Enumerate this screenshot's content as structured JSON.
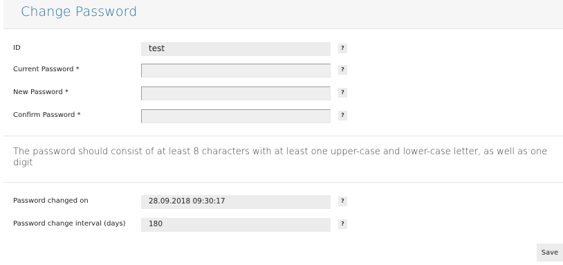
{
  "header": {
    "title": "Change Password"
  },
  "form": {
    "id": {
      "label": "ID",
      "value": "test",
      "help": "?"
    },
    "current_password": {
      "label": "Current Password *",
      "value": "",
      "help": "?"
    },
    "new_password": {
      "label": "New Password *",
      "value": "",
      "help": "?"
    },
    "confirm_password": {
      "label": "Confirm Password *",
      "value": "",
      "help": "?"
    }
  },
  "info": {
    "text": "The password should consist of at least 8 characters with at least one upper-case and lower-case letter, as well as one digit"
  },
  "details": {
    "changed_on": {
      "label": "Password changed on",
      "value": "28.09.2018 09:30:17",
      "help": "?"
    },
    "interval": {
      "label": "Password change interval (days)",
      "value": "180",
      "help": "?"
    }
  },
  "actions": {
    "save_label": "Save"
  }
}
